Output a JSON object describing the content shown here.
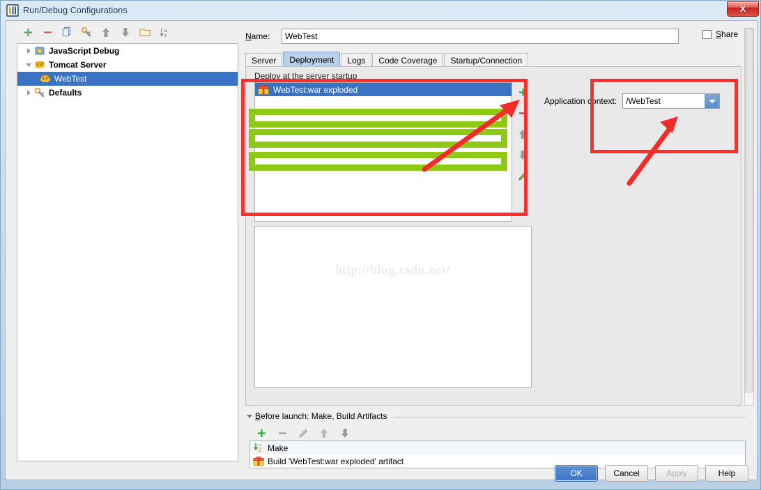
{
  "window": {
    "title": "Run/Debug Configurations",
    "app_icon": "intellij-idea-icon",
    "close_label": "X"
  },
  "left_toolbar": {
    "items": [
      {
        "name": "add-configuration-button",
        "icon": "plus-icon",
        "label": "+"
      },
      {
        "name": "remove-configuration-button",
        "icon": "minus-icon",
        "label": "−"
      },
      {
        "name": "copy-configuration-button",
        "icon": "copy-icon",
        "label": ""
      },
      {
        "name": "edit-defaults-button",
        "icon": "wrench-icon",
        "label": ""
      },
      {
        "name": "move-up-button",
        "icon": "arrow-up-icon",
        "label": ""
      },
      {
        "name": "move-down-button",
        "icon": "arrow-down-icon",
        "label": ""
      },
      {
        "name": "move-into-folder-button",
        "icon": "folder-icon",
        "label": ""
      },
      {
        "name": "sort-alphabetically-button",
        "icon": "sort-az-icon",
        "label": ""
      }
    ]
  },
  "tree": {
    "items": [
      {
        "label": "JavaScript Debug",
        "icon": "javascript-debug-icon",
        "expanded": false,
        "bold": true,
        "selected": false,
        "indent": 0
      },
      {
        "label": "Tomcat Server",
        "icon": "tomcat-icon",
        "expanded": true,
        "bold": true,
        "selected": false,
        "indent": 0
      },
      {
        "label": "WebTest",
        "icon": "tomcat-icon",
        "expanded": null,
        "bold": false,
        "selected": true,
        "indent": 1
      },
      {
        "label": "Defaults",
        "icon": "wrench-icon",
        "expanded": false,
        "bold": true,
        "selected": false,
        "indent": 0
      }
    ]
  },
  "name_field": {
    "label": "Name:",
    "label_mnemonic": "N",
    "value": "WebTest"
  },
  "share": {
    "label": "Share",
    "label_mnemonic": "S",
    "checked": false
  },
  "tabs": [
    {
      "label": "Server",
      "active": false
    },
    {
      "label": "Deployment",
      "active": true
    },
    {
      "label": "Logs",
      "active": false
    },
    {
      "label": "Code Coverage",
      "active": false
    },
    {
      "label": "Startup/Connection",
      "active": false
    }
  ],
  "deployment": {
    "section_label": "Deploy at the server startup",
    "artifacts": [
      {
        "label": "WebTest:war exploded",
        "icon": "artifact-icon",
        "selected": true
      }
    ],
    "side_buttons": [
      {
        "name": "add-artifact-button",
        "icon": "plus-icon"
      },
      {
        "name": "remove-artifact-button",
        "icon": "minus-icon"
      },
      {
        "name": "move-artifact-up-button",
        "icon": "arrow-up-icon"
      },
      {
        "name": "move-artifact-down-button",
        "icon": "arrow-down-icon"
      },
      {
        "name": "edit-artifact-button",
        "icon": "pencil-icon"
      }
    ],
    "application_context": {
      "label": "Application context:",
      "value": "/WebTest"
    }
  },
  "watermark": "http://blog.csdn.net/",
  "before_launch": {
    "header": "Before launch: Make, Build Artifacts",
    "header_mnemonic": "B",
    "toolbar": [
      {
        "name": "add-task-button",
        "icon": "plus-icon"
      },
      {
        "name": "remove-task-button",
        "icon": "minus-icon"
      },
      {
        "name": "edit-task-button",
        "icon": "pencil-icon"
      },
      {
        "name": "move-task-up-button",
        "icon": "arrow-up-icon"
      },
      {
        "name": "move-task-down-button",
        "icon": "arrow-down-icon"
      }
    ],
    "tasks": [
      {
        "label": "Make",
        "icon": "make-icon"
      },
      {
        "label": "Build 'WebTest:war exploded' artifact",
        "icon": "artifact-icon"
      }
    ]
  },
  "dialog_buttons": [
    {
      "label": "OK",
      "name": "ok-button",
      "style": "primary",
      "enabled": true
    },
    {
      "label": "Cancel",
      "name": "cancel-button",
      "style": "normal",
      "enabled": true
    },
    {
      "label": "Apply",
      "name": "apply-button",
      "style": "disabled",
      "enabled": false
    },
    {
      "label": "Help",
      "name": "help-button",
      "style": "normal",
      "enabled": true
    }
  ],
  "annotations": {
    "red_color": "#f93030",
    "green_color": "#8ec916",
    "red_boxes": 2,
    "green_boxes": 3,
    "arrows": 2
  }
}
